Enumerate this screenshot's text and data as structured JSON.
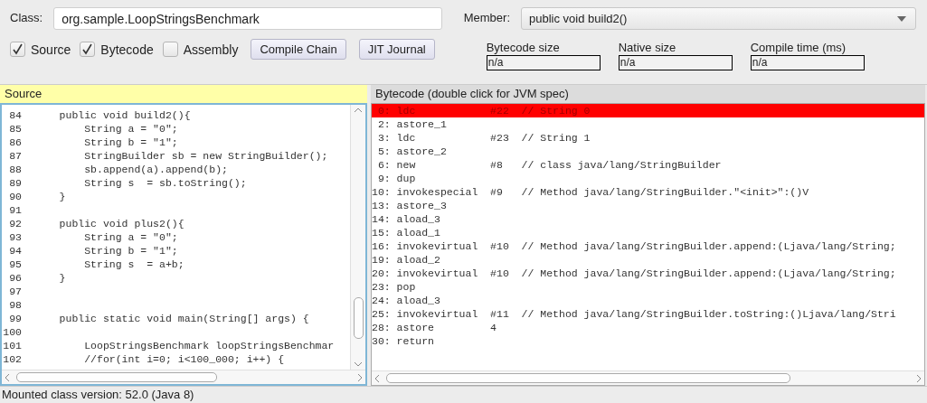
{
  "class_field": {
    "label": "Class:",
    "value": "org.sample.LoopStringsBenchmark"
  },
  "options": [
    {
      "label": "Source",
      "checked": true
    },
    {
      "label": "Bytecode",
      "checked": true
    },
    {
      "label": "Assembly",
      "checked": false
    }
  ],
  "buttons": [
    "Compile Chain",
    "JIT Journal"
  ],
  "member": {
    "label": "Member:",
    "value": "public void build2()"
  },
  "stats": [
    {
      "label": "Bytecode size",
      "value": "n/a"
    },
    {
      "label": "Native size",
      "value": "n/a"
    },
    {
      "label": "Compile time (ms)",
      "value": "n/a"
    }
  ],
  "source_pane": {
    "title": "Source",
    "lines": [
      {
        "number": "84",
        "code": "    public void build2(){"
      },
      {
        "number": "85",
        "code": "        String a = \"0\";"
      },
      {
        "number": "86",
        "code": "        String b = \"1\";"
      },
      {
        "number": "87",
        "code": "        StringBuilder sb = new StringBuilder();"
      },
      {
        "number": "88",
        "code": "        sb.append(a).append(b);"
      },
      {
        "number": "89",
        "code": "        String s  = sb.toString();"
      },
      {
        "number": "90",
        "code": "    }"
      },
      {
        "number": "91"
      },
      {
        "number": "92",
        "code": "    public void plus2(){"
      },
      {
        "number": "93",
        "code": "        String a = \"0\";"
      },
      {
        "number": "94",
        "code": "        String b = \"1\";"
      },
      {
        "number": "95",
        "code": "        String s  = a+b;"
      },
      {
        "number": "96",
        "code": "    }"
      },
      {
        "number": "97"
      },
      {
        "number": "98"
      },
      {
        "number": "99",
        "code": "    public static void main(String[] args) {"
      },
      {
        "number": "100"
      },
      {
        "number": "101",
        "code": "        LoopStringsBenchmark loopStringsBenchmar"
      },
      {
        "number": "102",
        "code": "        //for(int i=0; i<100_000; i++) {"
      }
    ]
  },
  "bytecode_pane": {
    "title": "Bytecode (double click for JVM spec)",
    "rows": [
      {
        "offset": "0:",
        "opcode": "ldc",
        "operand": "#22",
        "comment": "// String 0",
        "selected": true
      },
      {
        "offset": "2:",
        "opcode": "astore_1",
        "selected": false
      },
      {
        "offset": "3:",
        "opcode": "ldc",
        "operand": "#23",
        "comment": "// String 1",
        "selected": false
      },
      {
        "offset": "5:",
        "opcode": "astore_2",
        "selected": false
      },
      {
        "offset": "6:",
        "opcode": "new",
        "operand": "#8",
        "comment": "// class java/lang/StringBuilder",
        "selected": false
      },
      {
        "offset": "9:",
        "opcode": "dup",
        "selected": false
      },
      {
        "offset": "10:",
        "opcode": "invokespecial",
        "operand": "#9",
        "comment": "// Method java/lang/StringBuilder.\"<init>\":()V",
        "selected": false
      },
      {
        "offset": "13:",
        "opcode": "astore_3",
        "selected": false
      },
      {
        "offset": "14:",
        "opcode": "aload_3",
        "selected": false
      },
      {
        "offset": "15:",
        "opcode": "aload_1",
        "selected": false
      },
      {
        "offset": "16:",
        "opcode": "invokevirtual",
        "operand": "#10",
        "comment": "// Method java/lang/StringBuilder.append:(Ljava/lang/String;",
        "selected": false
      },
      {
        "offset": "19:",
        "opcode": "aload_2",
        "selected": false
      },
      {
        "offset": "20:",
        "opcode": "invokevirtual",
        "operand": "#10",
        "comment": "// Method java/lang/StringBuilder.append:(Ljava/lang/String;",
        "selected": false
      },
      {
        "offset": "23:",
        "opcode": "pop",
        "selected": false
      },
      {
        "offset": "24:",
        "opcode": "aload_3",
        "selected": false
      },
      {
        "offset": "25:",
        "opcode": "invokevirtual",
        "operand": "#11",
        "comment": "// Method java/lang/StringBuilder.toString:()Ljava/lang/Stri",
        "selected": false
      },
      {
        "offset": "28:",
        "opcode": "astore",
        "operand": "4",
        "selected": false
      },
      {
        "offset": "30:",
        "opcode": "return",
        "selected": false
      }
    ]
  },
  "status_bar": "Mounted class version: 52.0 (Java 8)"
}
